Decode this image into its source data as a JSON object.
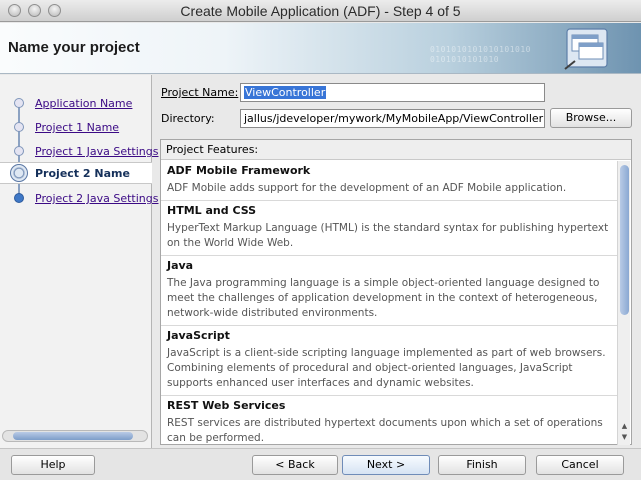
{
  "window": {
    "title": "Create Mobile Application (ADF) - Step 4 of 5"
  },
  "banner": {
    "title": "Name your project",
    "bits": "0101010101010101010\n0101010101010"
  },
  "steps": [
    {
      "label": "Application Name",
      "state": "done"
    },
    {
      "label": "Project 1 Name",
      "state": "done"
    },
    {
      "label": "Project 1 Java Settings",
      "state": "done"
    },
    {
      "label": "Project 2 Name",
      "state": "current"
    },
    {
      "label": "Project 2 Java Settings",
      "state": "todo"
    }
  ],
  "form": {
    "project_name_label": "Project Name:",
    "project_name_value": "ViewController",
    "directory_label": "Directory:",
    "directory_value": "jallus/jdeveloper/mywork/MyMobileApp/ViewController",
    "browse_label": "Browse..."
  },
  "features": {
    "header": "Project Features:",
    "items": [
      {
        "name": "ADF Mobile Framework",
        "desc": "ADF Mobile adds support for the development of an ADF Mobile application."
      },
      {
        "name": "HTML and CSS",
        "desc": "HyperText Markup Language (HTML) is the standard syntax for publishing hypertext on the World Wide Web."
      },
      {
        "name": "Java",
        "desc": "The Java programming language is a simple object-oriented language designed to meet the challenges of application development in the context of heterogeneous, network-wide distributed environments."
      },
      {
        "name": "JavaScript",
        "desc": "JavaScript is a client-side scripting language implemented as part of web browsers. Combining elements of procedural and object-oriented languages, JavaScript supports enhanced user interfaces and dynamic websites."
      },
      {
        "name": "REST Web Services",
        "desc": "REST services are distributed hypertext documents upon which a set of operations can be performed."
      }
    ]
  },
  "buttons": {
    "help": "Help",
    "back": "< Back",
    "next": "Next >",
    "finish": "Finish",
    "cancel": "Cancel"
  }
}
